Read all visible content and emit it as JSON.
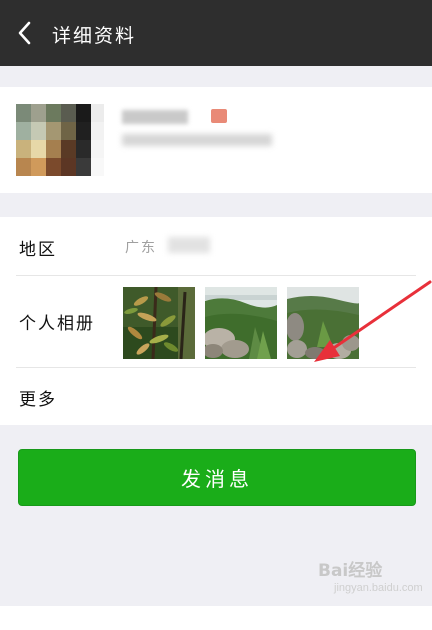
{
  "header": {
    "title": "详细资料"
  },
  "profile": {
    "name": "",
    "id": ""
  },
  "details": {
    "region_label": "地区",
    "region_value": "广东",
    "album_label": "个人相册",
    "more_label": "更多"
  },
  "actions": {
    "send_message_label": "发消息"
  },
  "watermark": {
    "text": "Bai经验",
    "sub": "jingyan.baidu.com"
  },
  "colors": {
    "titlebar": "#2e2e2e",
    "background": "#efeff4",
    "primary_button": "#1aad19",
    "annotation_arrow": "#e8303a"
  }
}
